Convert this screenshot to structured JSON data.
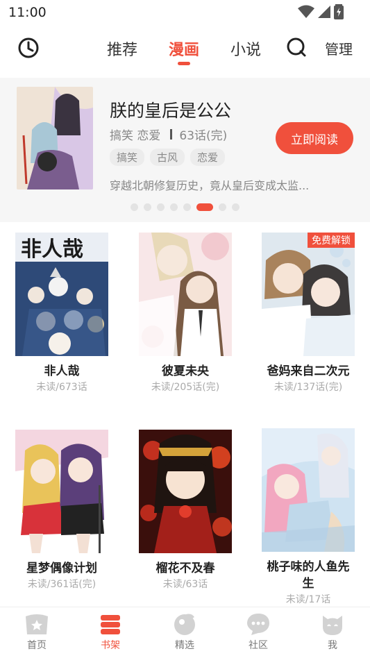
{
  "status": {
    "time": "11:00"
  },
  "tabs": [
    {
      "label": "推荐",
      "active": false
    },
    {
      "label": "漫画",
      "active": true
    },
    {
      "label": "小说",
      "active": false
    }
  ],
  "header": {
    "manage_label": "管理"
  },
  "banner": {
    "title": "朕的皇后是公公",
    "genres": "搞笑 恋爱",
    "chapters": "63话(完)",
    "tags": [
      "搞笑",
      "古风",
      "恋爱"
    ],
    "description": "穿越北朝修复历史，竟从皇后变成太监...",
    "read_button": "立即阅读",
    "dot_count": 9,
    "active_dot": 5
  },
  "comics": [
    {
      "title": "非人哉",
      "progress": "未读/673话",
      "badge": ""
    },
    {
      "title": "彼夏未央",
      "progress": "未读/205话(完)",
      "badge": ""
    },
    {
      "title": "爸妈来自二次元",
      "progress": "未读/137话(完)",
      "badge": "免费解锁"
    },
    {
      "title": "星梦偶像计划",
      "progress": "未读/361话(完)",
      "badge": ""
    },
    {
      "title": "榴花不及春",
      "progress": "未读/63话",
      "badge": ""
    },
    {
      "title": "桃子味的人鱼先生",
      "progress": "未读/17话",
      "badge": ""
    }
  ],
  "bottom_nav": [
    {
      "label": "首页",
      "icon": "home-icon",
      "active": false
    },
    {
      "label": "书架",
      "icon": "bookshelf-icon",
      "active": true
    },
    {
      "label": "精选",
      "icon": "featured-icon",
      "active": false
    },
    {
      "label": "社区",
      "icon": "community-icon",
      "active": false
    },
    {
      "label": "我",
      "icon": "profile-icon",
      "active": false
    }
  ],
  "colors": {
    "accent": "#f0503c",
    "inactive_icon": "#d2d2d2"
  }
}
